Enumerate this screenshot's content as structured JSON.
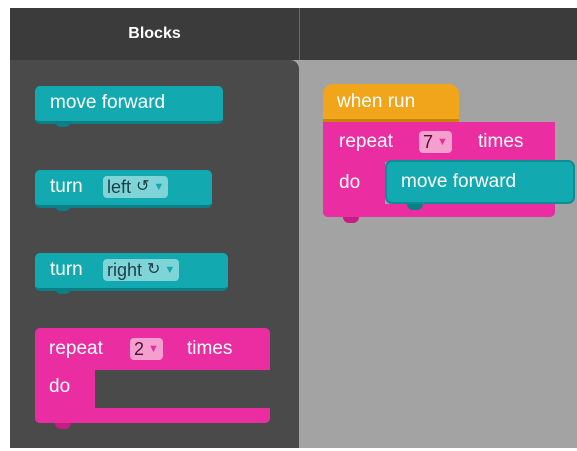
{
  "header": {
    "title": "Blocks"
  },
  "toolbox": {
    "move_forward": {
      "label": "move forward"
    },
    "turn_left": {
      "label": "turn",
      "option": "left",
      "symbol": "↺",
      "arrow": "▼"
    },
    "turn_right": {
      "label": "turn",
      "option": "right",
      "symbol": "↻",
      "arrow": "▼"
    },
    "repeat": {
      "label": "repeat",
      "count": "2",
      "arrow": "▼",
      "suffix": "times",
      "do_label": "do"
    }
  },
  "workspace": {
    "when_run": {
      "label": "when run"
    },
    "repeat": {
      "label": "repeat",
      "count": "7",
      "arrow": "▼",
      "suffix": "times",
      "do_label": "do"
    },
    "move_forward": {
      "label": "move forward"
    }
  },
  "colors": {
    "motion_block": "#12a9b1",
    "loop_block": "#ea2ea2",
    "event_block": "#f0a51a",
    "toolbox_bg": "#4a4a4a",
    "workspace_bg": "#a3a3a3",
    "header_bg": "#3b3b3b"
  }
}
